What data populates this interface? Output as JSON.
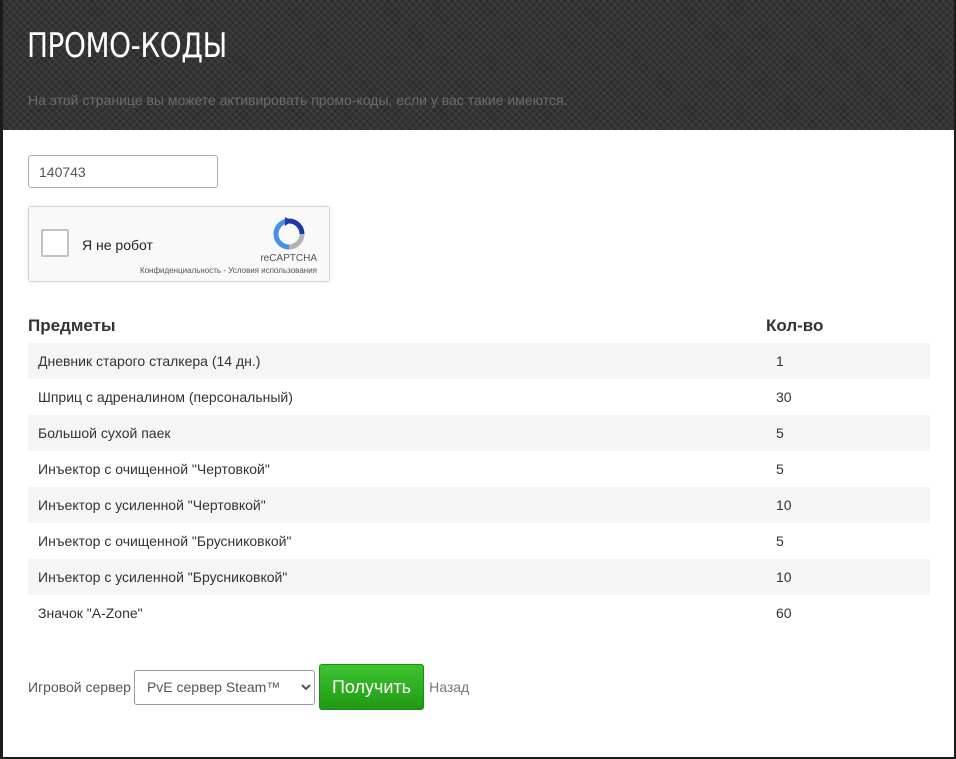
{
  "header": {
    "title": "ПРОМО-КОДЫ",
    "subtitle": "На этой странице вы можете активировать промо-коды, если у вас такие имеются."
  },
  "promo_input": {
    "value": "140743"
  },
  "captcha": {
    "label": "Я не робот",
    "brand": "reCAPTCHA",
    "privacy": "Конфиденциальность",
    "separator": " - ",
    "terms": "Условия использования"
  },
  "table": {
    "headers": {
      "item": "Предметы",
      "qty": "Кол-во"
    },
    "rows": [
      {
        "name": "Дневник старого сталкера (14 дн.)",
        "qty": "1"
      },
      {
        "name": "Шприц с адреналином (персональный)",
        "qty": "30"
      },
      {
        "name": "Большой сухой паек",
        "qty": "5"
      },
      {
        "name": "Инъектор с очищенной \"Чертовкой\"",
        "qty": "5"
      },
      {
        "name": "Инъектор с усиленной \"Чертовкой\"",
        "qty": "10"
      },
      {
        "name": "Инъектор с очищенной \"Брусниковкой\"",
        "qty": "5"
      },
      {
        "name": "Инъектор с усиленной \"Брусниковкой\"",
        "qty": "10"
      },
      {
        "name": "Значок \"A-Zone\"",
        "qty": "60"
      }
    ]
  },
  "footer": {
    "server_label": "Игровой сервер",
    "server_selected": "PvE сервер Steam™",
    "submit_label": "Получить",
    "back_label": "Назад"
  },
  "colors": {
    "accent": "#2cae1f",
    "header_bg": "#343434"
  },
  "icons": {
    "captcha_logo": "recaptcha-icon"
  }
}
